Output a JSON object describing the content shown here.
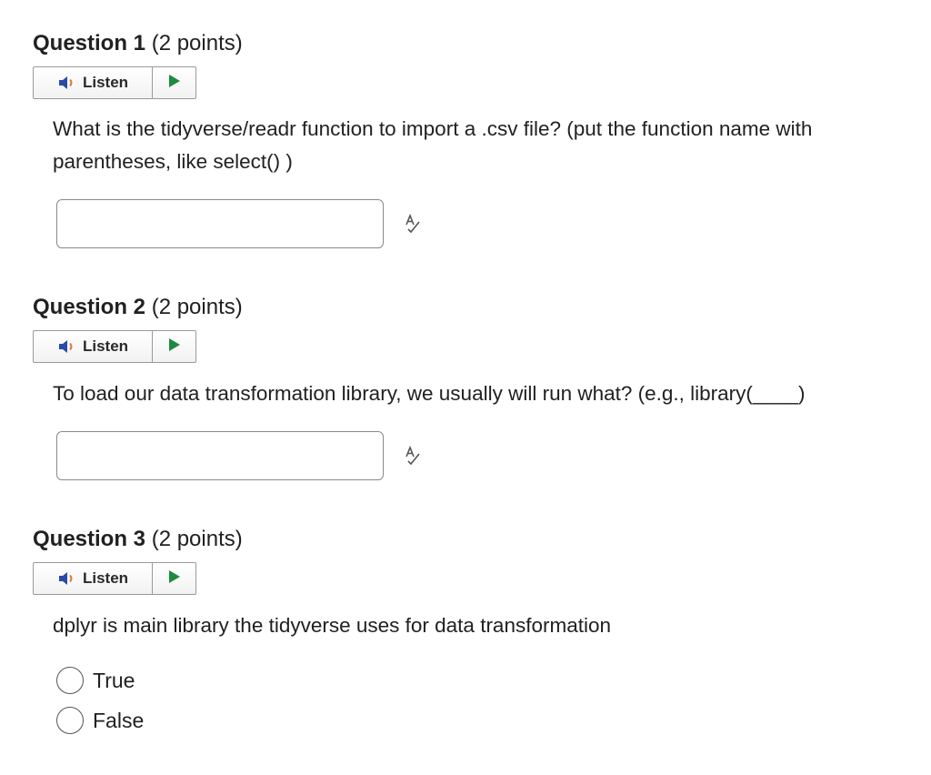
{
  "listen_label": "Listen",
  "colors": {
    "text": "#202122",
    "play_green": "#1e8a3e",
    "speaker_blue": "#2b4aa8",
    "speaker_waves": "#e0772f"
  },
  "icons": {
    "speaker": "speaker-icon",
    "play": "play-icon",
    "spellcheck": "spellcheck-icon"
  },
  "questions": [
    {
      "name": "Question 1",
      "points": "(2 points)",
      "text": "What is the tidyverse/readr function to import a .csv file? (put the function name with parentheses, like select() )",
      "answer_value": ""
    },
    {
      "name": "Question 2",
      "points": "(2 points)",
      "text": "To load our data transformation library, we usually will run what? (e.g., library(____)",
      "answer_value": ""
    },
    {
      "name": "Question 3",
      "points": "(2 points)",
      "text": "dplyr is main library the tidyverse uses for data transformation",
      "options": [
        "True",
        "False"
      ]
    }
  ]
}
